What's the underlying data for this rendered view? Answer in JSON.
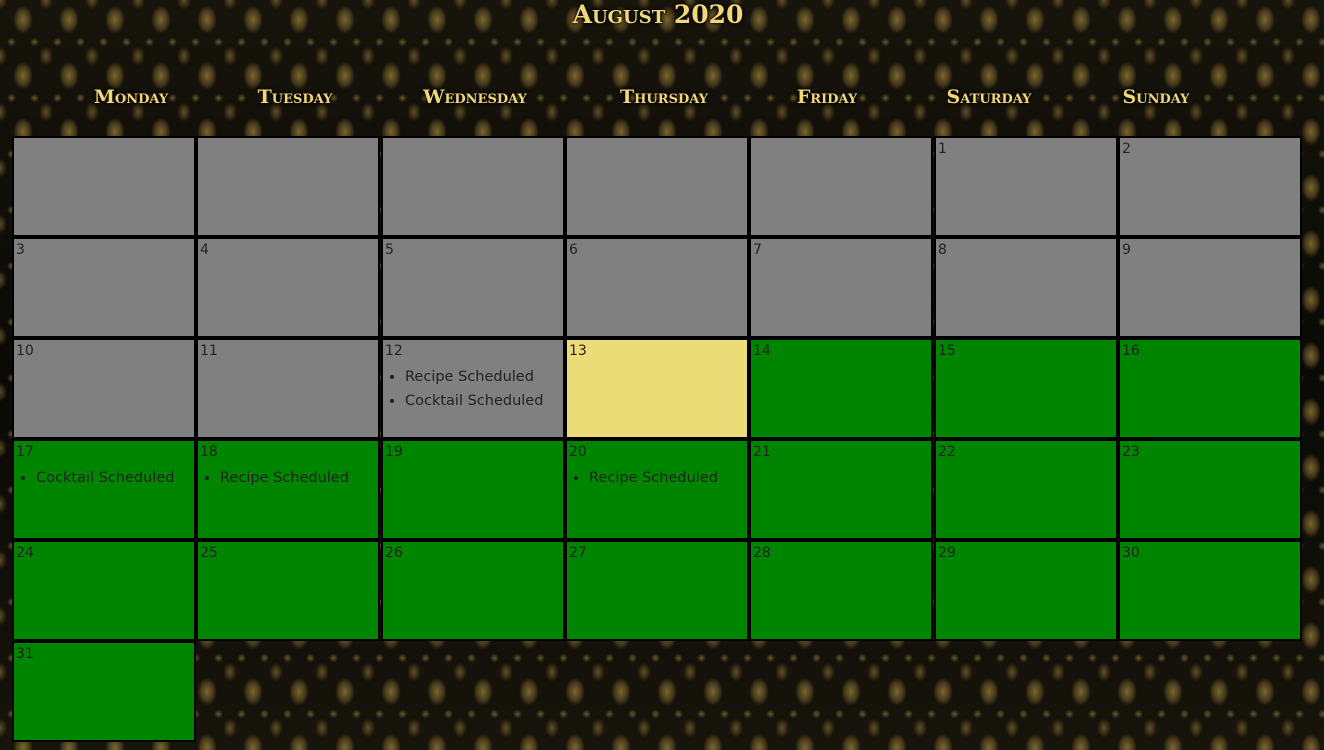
{
  "calendar": {
    "title": "August 2020",
    "weekdays": [
      "Monday",
      "Tuesday",
      "Wednesday",
      "Thursday",
      "Friday",
      "Saturday",
      "Sunday"
    ],
    "today": 13,
    "leading_blanks": 5,
    "days": [
      {
        "day": "1",
        "events": []
      },
      {
        "day": "2",
        "events": []
      },
      {
        "day": "3",
        "events": []
      },
      {
        "day": "4",
        "events": []
      },
      {
        "day": "5",
        "events": []
      },
      {
        "day": "6",
        "events": []
      },
      {
        "day": "7",
        "events": []
      },
      {
        "day": "8",
        "events": []
      },
      {
        "day": "9",
        "events": []
      },
      {
        "day": "10",
        "events": []
      },
      {
        "day": "11",
        "events": []
      },
      {
        "day": "12",
        "events": [
          "Recipe Scheduled",
          "Cocktail Scheduled"
        ]
      },
      {
        "day": "13",
        "events": []
      },
      {
        "day": "14",
        "events": []
      },
      {
        "day": "15",
        "events": []
      },
      {
        "day": "16",
        "events": []
      },
      {
        "day": "17",
        "events": [
          "Cocktail Scheduled"
        ]
      },
      {
        "day": "18",
        "events": [
          "Recipe Scheduled"
        ]
      },
      {
        "day": "19",
        "events": []
      },
      {
        "day": "20",
        "events": [
          "Recipe Scheduled"
        ]
      },
      {
        "day": "21",
        "events": []
      },
      {
        "day": "22",
        "events": []
      },
      {
        "day": "23",
        "events": []
      },
      {
        "day": "24",
        "events": []
      },
      {
        "day": "25",
        "events": []
      },
      {
        "day": "26",
        "events": []
      },
      {
        "day": "27",
        "events": []
      },
      {
        "day": "28",
        "events": []
      },
      {
        "day": "29",
        "events": []
      },
      {
        "day": "30",
        "events": []
      },
      {
        "day": "31",
        "events": []
      }
    ]
  },
  "colors": {
    "past": "#808080",
    "today": "#ebdc77",
    "future": "#008500",
    "heading": "#f1d77a"
  }
}
